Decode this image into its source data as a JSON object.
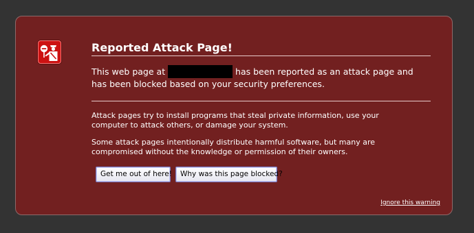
{
  "warning": {
    "title": "Reported Attack Page!",
    "intro_before": "This web page at ",
    "intro_after": " has been reported as an attack page and has been blocked based on your security preferences.",
    "paragraph_1": "Attack pages try to install programs that steal private information, use your computer to attack others, or damage your system.",
    "paragraph_2": "Some attack pages intentionally distribute harmful software, but many are compromised without the knowledge or permission of their owners.",
    "icon": "security-officer-icon",
    "colors": {
      "background": "#333333",
      "panel": "#722020",
      "icon_badge": "#cc1111"
    }
  },
  "actions": {
    "get_out_label": "Get me out of here!",
    "why_blocked_label": "Why was this page blocked?",
    "ignore_label": "Ignore this warning"
  }
}
